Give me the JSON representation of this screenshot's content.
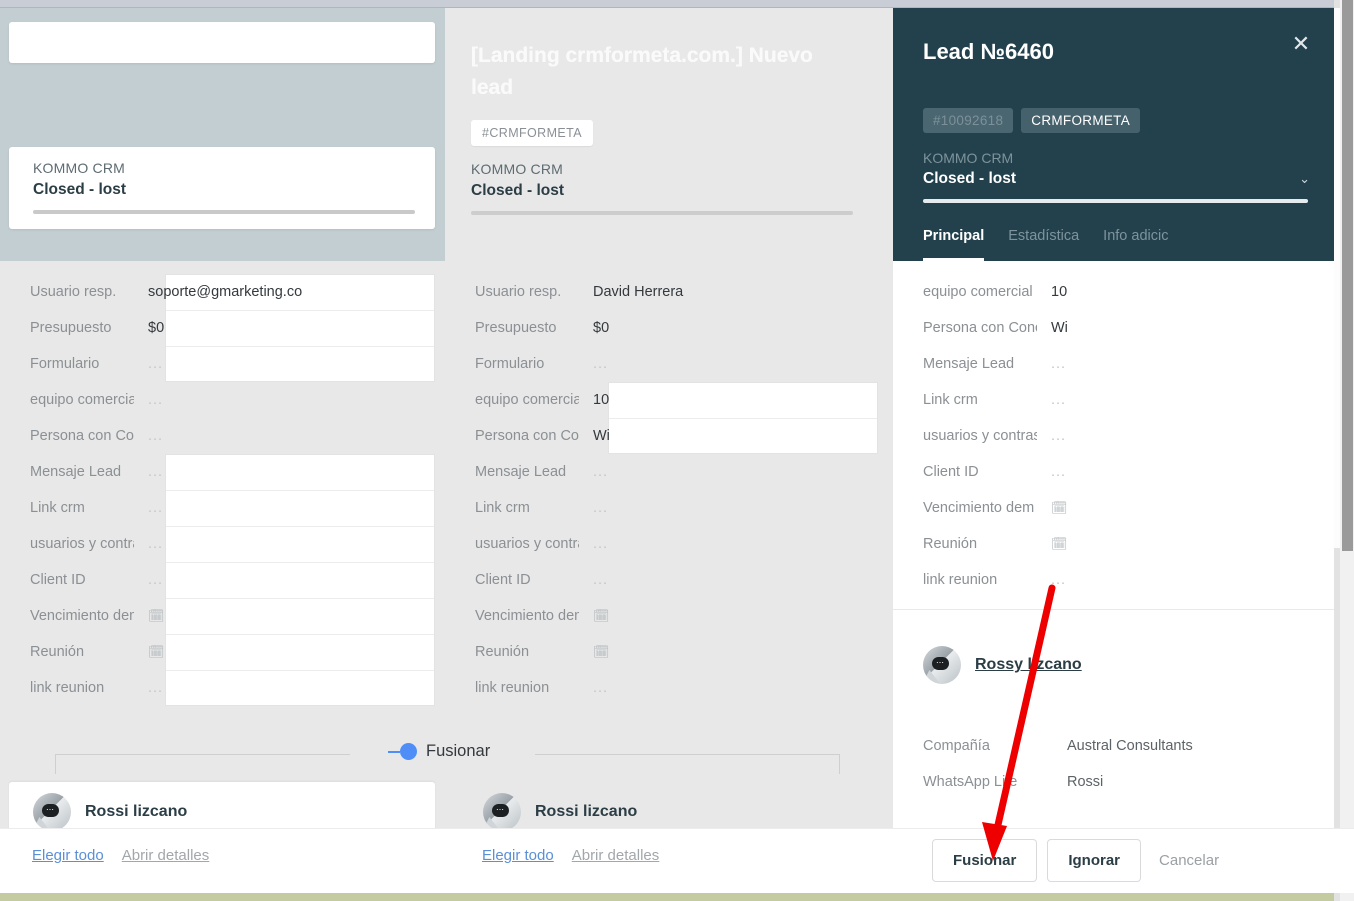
{
  "window": {
    "bottom_band_color": "#c5cba0",
    "accent_blue": "#4f8ef7",
    "dark_panel_color": "#23414d"
  },
  "left_panel": {
    "pipeline": "KOMMO CRM",
    "stage": "Closed - lost",
    "fields": [
      {
        "label": "Usuario resp.",
        "value": "soporte@gmarketing.co",
        "muted": false,
        "boxed": true,
        "type": "text"
      },
      {
        "label": "Presupuesto",
        "value": "$0",
        "muted": false,
        "boxed": true,
        "type": "text"
      },
      {
        "label": "Formulario",
        "value": "...",
        "muted": true,
        "boxed": true,
        "type": "text"
      },
      {
        "label": "equipo comercial",
        "value": "...",
        "muted": true,
        "boxed": false,
        "type": "text"
      },
      {
        "label": "Persona con Cono",
        "value": "...",
        "muted": true,
        "boxed": false,
        "type": "text"
      },
      {
        "label": "Mensaje Lead",
        "value": "...",
        "muted": true,
        "boxed": true,
        "type": "text"
      },
      {
        "label": "Link crm",
        "value": "...",
        "muted": true,
        "boxed": true,
        "type": "text"
      },
      {
        "label": "usuarios y contras",
        "value": "...",
        "muted": true,
        "boxed": true,
        "type": "text"
      },
      {
        "label": "Client ID",
        "value": "...",
        "muted": true,
        "boxed": true,
        "type": "text"
      },
      {
        "label": "Vencimiento dem",
        "value": "Ὄ5",
        "muted": true,
        "boxed": true,
        "type": "date"
      },
      {
        "label": "Reunión",
        "value": "",
        "muted": true,
        "boxed": true,
        "type": "date"
      },
      {
        "label": "link reunion",
        "value": "...",
        "muted": true,
        "boxed": true,
        "type": "text"
      }
    ],
    "contact_name": "Rossi lizcano",
    "footer_links": {
      "select_all": "Elegir todo",
      "open_details": "Abrir detalles"
    }
  },
  "mid_panel": {
    "title": "[Landing crmformeta.com.] Nuevo lead",
    "tag": "#CRMFORMETA",
    "pipeline": "KOMMO CRM",
    "stage": "Closed - lost",
    "fields": [
      {
        "label": "Usuario resp.",
        "value": "David Herrera",
        "muted": false,
        "boxed": false,
        "type": "text"
      },
      {
        "label": "Presupuesto",
        "value": "$0",
        "muted": false,
        "boxed": false,
        "type": "text"
      },
      {
        "label": "Formulario",
        "value": "...",
        "muted": true,
        "boxed": false,
        "type": "text"
      },
      {
        "label": "equipo comercial",
        "value": "10",
        "muted": false,
        "boxed": true,
        "type": "text"
      },
      {
        "label": "Persona con Cono",
        "value": "Wi",
        "muted": false,
        "boxed": true,
        "type": "text"
      },
      {
        "label": "Mensaje Lead",
        "value": "...",
        "muted": true,
        "boxed": false,
        "type": "text"
      },
      {
        "label": "Link crm",
        "value": "...",
        "muted": true,
        "boxed": false,
        "type": "text"
      },
      {
        "label": "usuarios y contras",
        "value": "...",
        "muted": true,
        "boxed": false,
        "type": "text"
      },
      {
        "label": "Client ID",
        "value": "...",
        "muted": true,
        "boxed": false,
        "type": "text"
      },
      {
        "label": "Vencimiento dem",
        "value": "",
        "muted": true,
        "boxed": false,
        "type": "date"
      },
      {
        "label": "Reunión",
        "value": "",
        "muted": true,
        "boxed": false,
        "type": "date"
      },
      {
        "label": "link reunion",
        "value": "...",
        "muted": true,
        "boxed": false,
        "type": "text"
      }
    ],
    "contact_name": "Rossi lizcano",
    "footer_links": {
      "select_all": "Elegir todo",
      "open_details": "Abrir detalles"
    }
  },
  "right_panel": {
    "title": "Lead №6460",
    "tag_id": "#10092618",
    "tag_name": "CRMFORMETA",
    "pipeline": "KOMMO CRM",
    "stage": "Closed - lost",
    "tabs": [
      {
        "label": "Principal",
        "active": true
      },
      {
        "label": "Estadística",
        "active": false
      },
      {
        "label": "Info adicic",
        "active": false
      }
    ],
    "fields": [
      {
        "label": "equipo comercial",
        "value": "10",
        "muted": false,
        "type": "text"
      },
      {
        "label": "Persona con Cono",
        "value": "Wi",
        "muted": false,
        "type": "text"
      },
      {
        "label": "Mensaje Lead",
        "value": "...",
        "muted": true,
        "type": "text"
      },
      {
        "label": "Link crm",
        "value": "...",
        "muted": true,
        "type": "text"
      },
      {
        "label": "usuarios y contras",
        "value": "...",
        "muted": true,
        "type": "text"
      },
      {
        "label": "Client ID",
        "value": "...",
        "muted": true,
        "type": "text"
      },
      {
        "label": "Vencimiento dem",
        "value": "",
        "muted": true,
        "type": "date"
      },
      {
        "label": "Reunión",
        "value": "",
        "muted": true,
        "type": "date"
      },
      {
        "label": "link reunion",
        "value": "...",
        "muted": true,
        "type": "text"
      }
    ],
    "contact": {
      "name": "Rossy lizcano",
      "rows": [
        {
          "label": "Compañía",
          "value": "Austral Consultants"
        },
        {
          "label": "WhatsApp Lite",
          "value": "Rossi"
        }
      ]
    }
  },
  "merge_divider": {
    "label": "Fusionar"
  },
  "footer": {
    "buttons": {
      "merge": "Fusionar",
      "ignore": "Ignorar",
      "cancel": "Cancelar"
    }
  }
}
